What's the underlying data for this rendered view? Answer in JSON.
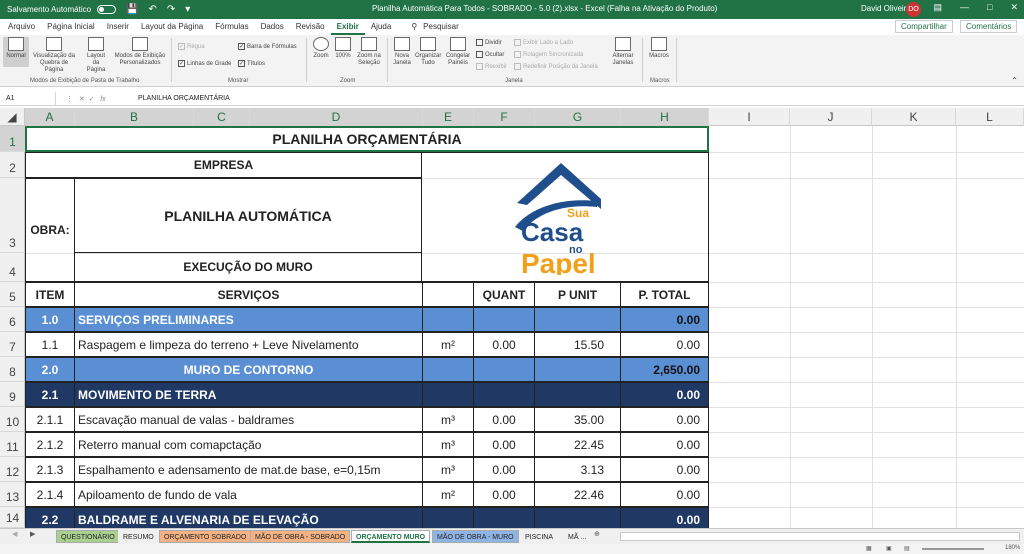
{
  "titlebar": {
    "autosave_label": "Salvamento Automático",
    "title": "Planilha Automática Para Todos - SOBRADO - 5.0 (2).xlsx  -  Excel (Falha na Ativação do Produto)",
    "user_name": "David Oliveira",
    "avatar_initials": "DO"
  },
  "menu": {
    "tabs": [
      "Arquivo",
      "Página Inicial",
      "Inserir",
      "Layout da Página",
      "Fórmulas",
      "Dados",
      "Revisão",
      "Exibir",
      "Ajuda"
    ],
    "search": "Pesquisar",
    "share": "Compartilhar",
    "comments": "Comentários"
  },
  "ribbon": {
    "normal": "Normal",
    "page_break": "Visualização da Quebra de Página",
    "page_layout": "Layout da Página",
    "custom_views": "Modos de Exibição Personalizados",
    "group_views": "Modos de Exibição de Pasta de Trabalho",
    "ruler": "Régua",
    "formula_bar": "Barra de Fórmulas",
    "gridlines": "Linhas de Grade",
    "headings": "Títulos",
    "group_show": "Mostrar",
    "zoom": "Zoom",
    "zoom100": "100%",
    "zoom_selection": "Zoom na Seleção",
    "group_zoom": "Zoom",
    "new_window": "Nova Janela",
    "arrange_all": "Organizar Tudo",
    "freeze_panes": "Congelar Painéis",
    "split": "Dividir",
    "hide": "Ocultar",
    "unhide": "Reexibir",
    "side_by_side": "Exibir Lado a Lado",
    "sync_scroll": "Rolagem Sincronizada",
    "reset_position": "Redefinir Posição da Janela",
    "switch_windows": "Alternar Janelas",
    "group_window": "Janela",
    "macros": "Macros",
    "group_macros": "Macros"
  },
  "formula": {
    "namebox": "A1",
    "value": "PLANILHA ORÇAMENTÁRIA"
  },
  "columns": [
    "A",
    "B",
    "C",
    "D",
    "E",
    "F",
    "G",
    "H",
    "I",
    "J",
    "K",
    "L"
  ],
  "rows": [
    "1",
    "2",
    "3",
    "4",
    "5",
    "6",
    "7",
    "8",
    "9",
    "10",
    "11",
    "12",
    "13",
    "14"
  ],
  "sheet": {
    "title": "PLANILHA ORÇAMENTÁRIA",
    "empresa": "EMPRESA",
    "obra_label": "OBRA:",
    "obra_name": "PLANILHA AUTOMÁTICA",
    "execucao": "EXECUÇÃO DO MURO",
    "logo_line1": "Sua",
    "logo_line2": "Casa",
    "logo_line3": "no",
    "logo_line4": "Papel",
    "headers": {
      "item": "ITEM",
      "servicos": "SERVIÇOS",
      "quant": "QUANT",
      "punit": "P UNIT",
      "ptotal": "P. TOTAL"
    },
    "r6": {
      "item": "1.0",
      "desc": "SERVIÇOS PRELIMINARES",
      "total": "0.00"
    },
    "r7": {
      "item": "1.1",
      "desc": "Raspagem e limpeza do terreno + Leve Nivelamento",
      "unit": "m²",
      "quant": "0.00",
      "punit": "15.50",
      "total": "0.00"
    },
    "r8": {
      "item": "2.0",
      "desc": "MURO DE CONTORNO",
      "total": "2,650.00"
    },
    "r9": {
      "item": "2.1",
      "desc": "MOVIMENTO DE TERRA",
      "total": "0.00"
    },
    "r10": {
      "item": "2.1.1",
      "desc": "Escavação manual de valas - baldrames",
      "unit": "m³",
      "quant": "0.00",
      "punit": "35.00",
      "total": "0.00"
    },
    "r11": {
      "item": "2.1.2",
      "desc": "Reterro manual com comapctação",
      "unit": "m³",
      "quant": "0.00",
      "punit": "22.45",
      "total": "0.00"
    },
    "r12": {
      "item": "2.1.3",
      "desc": "Espalhamento e adensamento de mat.de base, e=0,15m",
      "unit": "m³",
      "quant": "0.00",
      "punit": "3.13",
      "total": "0.00"
    },
    "r13": {
      "item": "2.1.4",
      "desc": "Apiloamento de fundo de vala",
      "unit": "m²",
      "quant": "0.00",
      "punit": "22.46",
      "total": "0.00"
    },
    "r14": {
      "item": "2.2",
      "desc": "BALDRAME E ALVENARIA DE ELEVAÇÃO",
      "total": "0.00"
    }
  },
  "sheet_tabs": [
    "QUESTIONÁRIO",
    "RESUMO",
    "ORÇAMENTO SOBRADO",
    "MÃO DE OBRA - SOBRADO",
    "ORÇAMENTO MURO",
    "MÃO DE OBRA - MURO",
    "PISCINA",
    "MÃ ..."
  ],
  "zoom_level": "180%",
  "colors": {
    "excel_green": "#217346",
    "section_blue": "#5b8fd4",
    "section_navy": "#1f3864",
    "logo_navy": "#1f4e8c",
    "logo_orange": "#f29f19"
  }
}
